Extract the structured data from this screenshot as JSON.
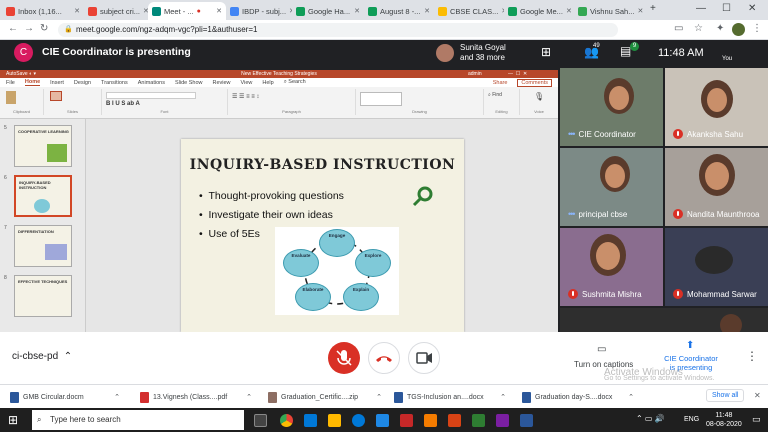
{
  "tabs": [
    "Inbox (1,16...",
    "subject cri...",
    "Meet - ...",
    "IBDP - subj...",
    "Google Ha...",
    "August 8 -...",
    "CBSE CLAS...",
    "Google Me...",
    "Vishnu Sah..."
  ],
  "url": "meet.google.com/ngz-adqm-vgc?pli=1&authuser=1",
  "meet": {
    "initial": "C",
    "presenting": "CIE Coordinator is presenting",
    "viewer_name": "Sunita Goyal",
    "viewer_more": "and 38 more",
    "people_count": "49",
    "chat_count": "9",
    "time": "11:48 AM",
    "you": "You"
  },
  "ppt": {
    "window_title": "New Effective Teaching Strategies",
    "account": "admin",
    "menu": [
      "File",
      "Home",
      "Insert",
      "Design",
      "Transitions",
      "Animations",
      "Slide Show",
      "Review",
      "View",
      "Help",
      "Search"
    ],
    "share": "Share",
    "comments": "Comments",
    "groups": [
      "Clipboard",
      "Slides",
      "Font",
      "Paragraph",
      "Drawing",
      "Editing",
      "Voice"
    ],
    "thumbs": [
      {
        "num": "5",
        "text": "COOPERATIVE LEARNING"
      },
      {
        "num": "6",
        "text": "INQUIRY-BASED INSTRUCTION"
      },
      {
        "num": "7",
        "text": "DIFFERENTIATION"
      },
      {
        "num": "8",
        "text": "EFFECTIVE TECHNIQUES"
      }
    ],
    "slide": {
      "title": "INQUIRY-BASED INSTRUCTION",
      "bullets": [
        "Thought-provoking questions",
        "Investigate their own ideas",
        "Use of  5Es"
      ],
      "cycle": [
        "Engage",
        "Explore",
        "Explain",
        "Elaborate",
        "Evaluate"
      ]
    }
  },
  "participants": [
    "CIE Coordinator",
    "Akanksha Sahu",
    "principal cbse",
    "Nandita Maunthrooa",
    "Sushmita Mishra",
    "Mohammad Sarwar"
  ],
  "controls": {
    "meeting_code": "ci-cbse-pd",
    "captions": "Turn on captions",
    "present_label": "CIE Coordinator\nis presenting",
    "activate1": "Activate Windows",
    "activate2": "Go to Settings to activate Windows."
  },
  "downloads": [
    "GMB Circular.docm",
    "13.Vignesh (Class....pdf",
    "Graduation_Certific....zip",
    "TGS-Inclusion an....docx",
    "Graduation day-S....docx"
  ],
  "show_all": "Show all",
  "taskbar": {
    "search": "Type here to search",
    "lang": "ENG",
    "time": "11:48",
    "date": "08-08-2020"
  },
  "colors": {
    "ppt_accent": "#b7472a",
    "meet_dark": "#202124",
    "end_call": "#d93025"
  }
}
